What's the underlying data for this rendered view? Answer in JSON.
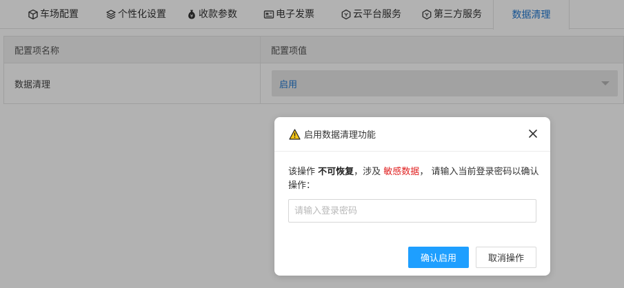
{
  "tabs": [
    {
      "label": "车场配置",
      "icon": "cube-icon"
    },
    {
      "label": "个性化设置",
      "icon": "layers-icon"
    },
    {
      "label": "收款参数",
      "icon": "money-bag-icon"
    },
    {
      "label": "电子发票",
      "icon": "invoice-icon"
    },
    {
      "label": "云平台服务",
      "icon": "hexagon-icon"
    },
    {
      "label": "第三方服务",
      "icon": "hexagon-icon"
    },
    {
      "label": "数据清理",
      "icon": "",
      "active": true
    }
  ],
  "table": {
    "headers": [
      "配置项名称",
      "配置项值"
    ],
    "rows": [
      {
        "name": "数据清理",
        "value": "启用"
      }
    ]
  },
  "dialog": {
    "title": "启用数据清理功能",
    "message": {
      "part1": "该操作 ",
      "bold": "不可恢复",
      "part2": "，涉及 ",
      "red": "敏感数据",
      "part3": "，  请输入当前登录密码以确认操作："
    },
    "password_placeholder": "请输入登录密码",
    "confirm_label": "确认启用",
    "cancel_label": "取消操作"
  },
  "colors": {
    "accent": "#1f78d1",
    "primary_button": "#1e9fff",
    "danger_text": "#e02020"
  }
}
